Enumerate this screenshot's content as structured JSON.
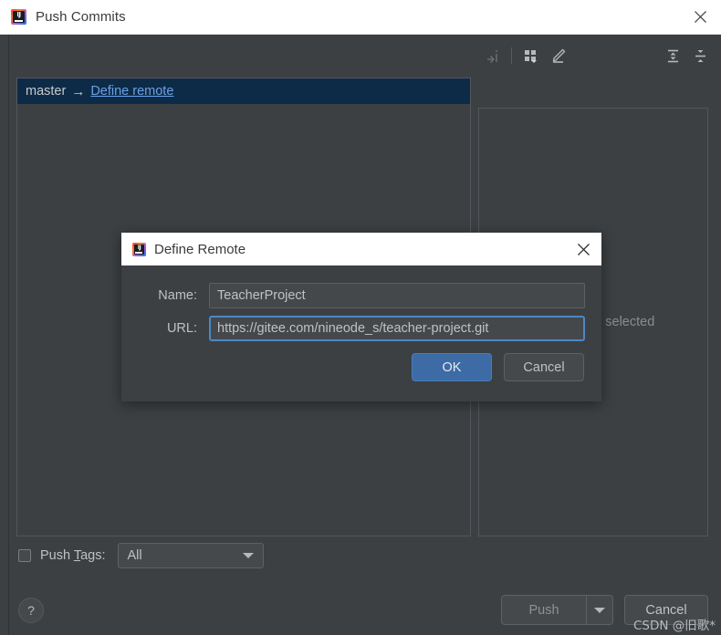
{
  "window": {
    "title": "Push Commits",
    "app_icon": "intellij-idea-icon",
    "close_icon": "close-icon"
  },
  "toolbar": {
    "items": [
      {
        "name": "collapse-to-left-icon",
        "label": ""
      },
      {
        "name": "group-by-icon",
        "label": ""
      },
      {
        "name": "edit-icon",
        "label": ""
      },
      {
        "name": "expand-all-icon",
        "label": ""
      },
      {
        "name": "collapse-all-icon",
        "label": ""
      }
    ]
  },
  "commits_panel": {
    "selected_row": {
      "branch": "master",
      "arrow": "→",
      "remote_link": "Define remote"
    }
  },
  "details_panel": {
    "empty_text": "No commits selected"
  },
  "bottom": {
    "push_tags_label_pre": "Push ",
    "push_tags_mnemonic": "T",
    "push_tags_label_post": "ags:",
    "push_tags_checked": false,
    "tags_combo_value": "All",
    "help_label": "?",
    "push_label": "Push",
    "cancel_label": "Cancel"
  },
  "watermark": {
    "text": "CSDN @旧歌*"
  },
  "dialog": {
    "title": "Define Remote",
    "app_icon": "intellij-idea-icon",
    "close_icon": "close-icon",
    "fields": [
      {
        "label": "Name:",
        "value": "TeacherProject",
        "focused": false
      },
      {
        "label": "URL:",
        "value": "https://gitee.com/nineode_s/teacher-project.git",
        "focused": true
      }
    ],
    "ok_label": "OK",
    "cancel_label": "Cancel"
  },
  "colors": {
    "background": "#3c4043",
    "titlebar": "#ffffff",
    "selection": "#0d2b47",
    "link": "#6aa0e8",
    "accent": "#3c6ba5",
    "focus_border": "#4a88c7",
    "text": "#bfc1c2"
  }
}
